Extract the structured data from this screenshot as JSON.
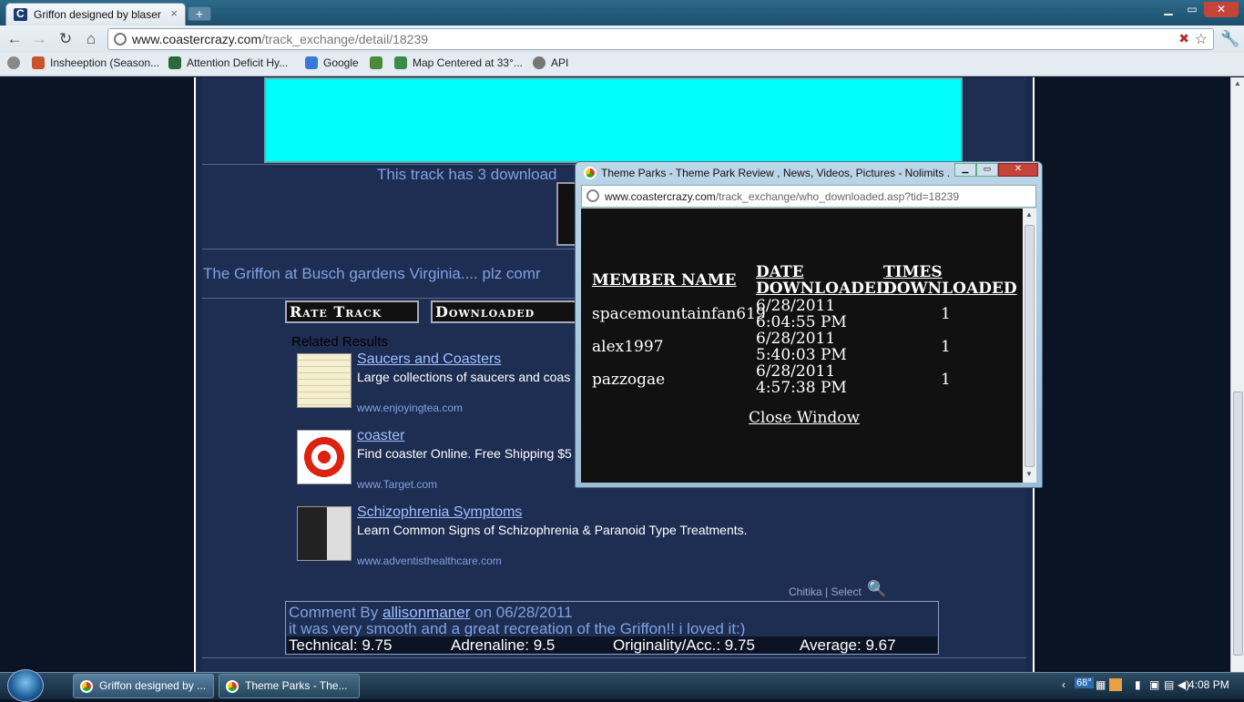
{
  "browser": {
    "tab_title": "Griffon designed by blaserr",
    "tab_close": "×",
    "new_tab": "+",
    "url_host": "www.coastercrazy.com",
    "url_path": "/track_exchange/detail/18239",
    "window_min": "▁",
    "window_max": "▭",
    "window_close": "✕"
  },
  "bookmarks": [
    {
      "label": "Insheeption (Season...",
      "color": "#c8542a"
    },
    {
      "label": "Attention Deficit Hy...",
      "color": "#2a6a3a"
    },
    {
      "label": "Google",
      "color": "#3a78d8"
    },
    {
      "label": "",
      "color": "#4a8a3a"
    },
    {
      "label": "Map Centered at 33°...",
      "color": "#3a8a4a"
    },
    {
      "label": "API",
      "color": "#777777"
    }
  ],
  "page": {
    "downloads_text": "This track has 3 download",
    "description": "The Griffon at Busch gardens Virginia.... plz comr",
    "rate_track": "Rate Track",
    "downloaded": "Downloaded",
    "related_heading": "Related Results",
    "related": [
      {
        "title": "Saucers and Coasters",
        "desc": "Large collections of saucers and coas",
        "url": "www.enjoyingtea.com"
      },
      {
        "title": "coaster",
        "desc": "Find coaster Online. Free Shipping $5",
        "url": "www.Target.com"
      },
      {
        "title": "Schizophrenia Symptoms",
        "desc": "Learn Common Signs of Schizophrenia & Paranoid Type Treatments.",
        "url": "www.adventisthealthcare.com"
      }
    ],
    "chitika": "Chitika | Select",
    "comment": {
      "prefix": "Comment By",
      "author": "allisonmaner",
      "date": "on 06/28/2011",
      "text": "it was very smooth and a great recreation of the Griffon!! i loved it:)",
      "technical": "Technical: 9.75",
      "adrenaline": "Adrenaline: 9.5",
      "originality": "Originality/Acc.: 9.75",
      "average": "Average: 9.67"
    }
  },
  "popup": {
    "title": "Theme Parks - Theme Park Review , News, Videos, Pictures - Nolimits ...",
    "url_host": "www.coastercrazy.com",
    "url_path": "/track_exchange/who_downloaded.asp?tid=18239",
    "headers": {
      "member": "MEMBER NAME",
      "date1": "DATE",
      "date2": "DOWNLOADED",
      "times1": "TIMES",
      "times2": "DOWNLOADED"
    },
    "rows": [
      {
        "member": "spacemountainfan619",
        "date": "6/28/2011",
        "time": "6:04:55 PM",
        "times": "1"
      },
      {
        "member": "alex1997",
        "date": "6/28/2011",
        "time": "5:40:03 PM",
        "times": "1"
      },
      {
        "member": "pazzogae",
        "date": "6/28/2011",
        "time": "4:57:38 PM",
        "times": "1"
      }
    ],
    "close": "Close Window"
  },
  "taskbar": {
    "task1": "Griffon designed by ...",
    "task2": "Theme Parks - The...",
    "temp": "68°",
    "time": "4:08 PM"
  }
}
